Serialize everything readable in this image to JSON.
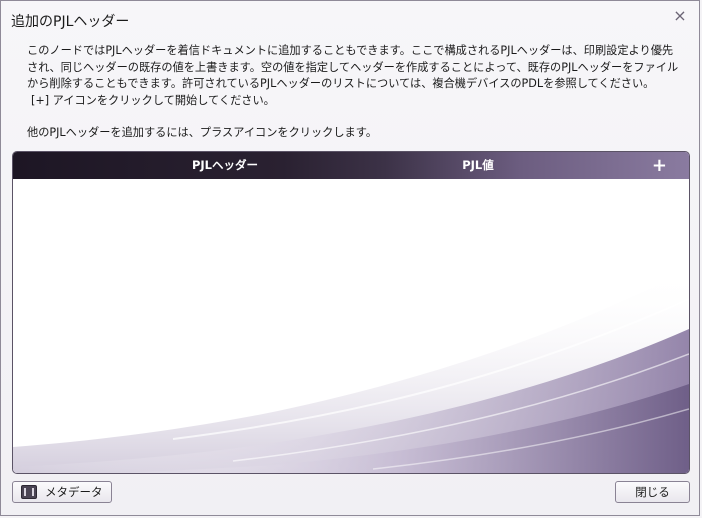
{
  "dialog": {
    "title": "追加のPJLヘッダー",
    "close_icon": "×",
    "description_lines": [
      "このノードではPJLヘッダーを着信ドキュメントに追加することもできます。ここで構成されるPJLヘッダーは、印刷設定より優先",
      "され、同じヘッダーの既存の値を上書きます。空の値を指定してヘッダーを作成することによって、既存のPJLヘッダーをファイル",
      "から削除することもできます。許可されているPJLヘッダーのリストについては、複合機デバイスのPDLを参照してください。",
      "[+] アイコンをクリックして開始してください。"
    ],
    "hint": "他のPJLヘッダーを追加するには、プラスアイコンをクリックします。"
  },
  "table": {
    "columns": [
      "PJLヘッダー",
      "PJL値"
    ],
    "add_icon": "+",
    "rows": []
  },
  "footer": {
    "metadata_label": "メタデータ",
    "close_label": "閉じる"
  }
}
